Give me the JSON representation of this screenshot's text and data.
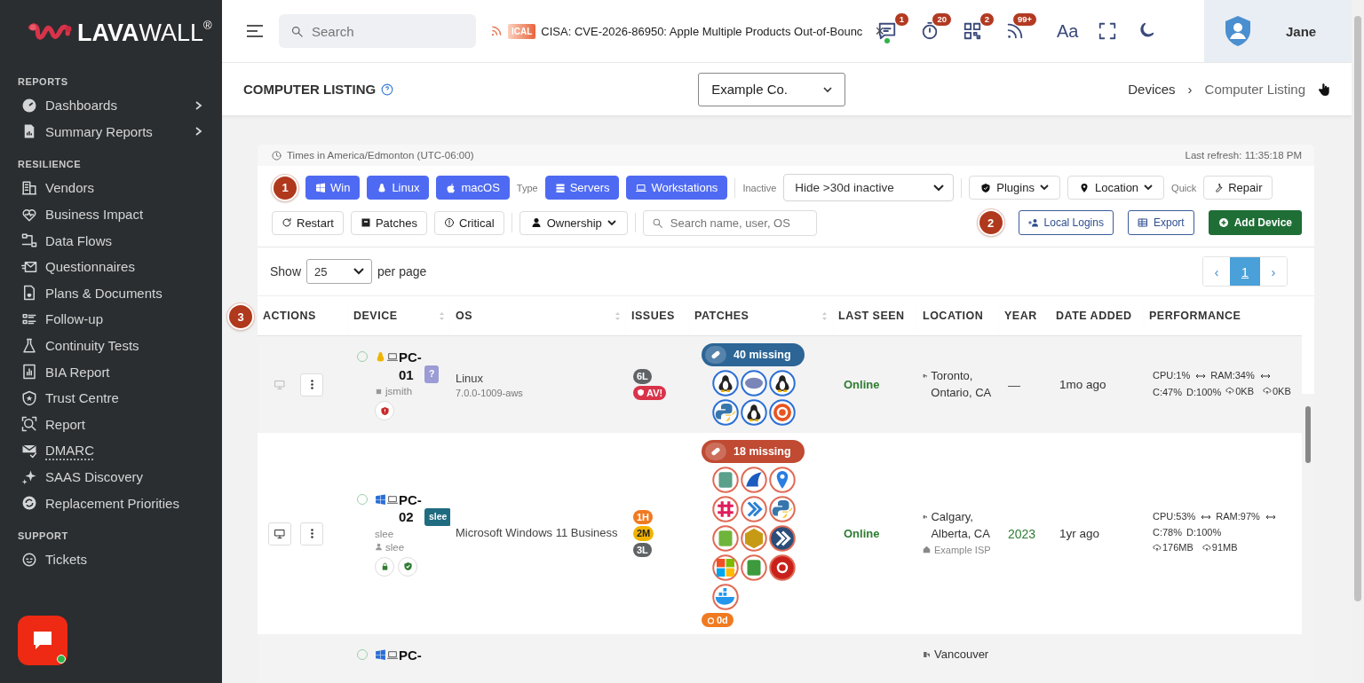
{
  "sidebar": {
    "logo": "**LAVA**WALL$^{®}$",
    "sections": [
      {
        "title": "REPORTS",
        "items": [
          {
            "label": "Dashboards",
            "has_submenu": true,
            "underlined": false
          },
          {
            "label": "Summary Reports",
            "has_submenu": true,
            "underlined": false
          }
        ]
      },
      {
        "title": "RESILIENCE",
        "items": [
          {
            "label": "Vendors",
            "has_submenu": false,
            "underlined": false
          },
          {
            "label": "Business Impact",
            "has_submenu": false,
            "underlined": false
          },
          {
            "label": "Data Flows",
            "has_submenu": false,
            "underlined": false
          },
          {
            "label": "Questionnaires",
            "has_submenu": false,
            "underlined": false
          },
          {
            "label": "Plans & Documents",
            "has_submenu": false,
            "underlined": false
          },
          {
            "label": "Follow-up",
            "has_submenu": false,
            "underlined": false
          },
          {
            "label": "Continuity Tests",
            "has_submenu": false,
            "underlined": false
          },
          {
            "label": "BIA Report",
            "has_submenu": false,
            "underlined": false
          },
          {
            "label": "Trust Centre",
            "has_submenu": false,
            "underlined": false
          },
          {
            "label": "Report",
            "has_submenu": false,
            "underlined": false
          },
          {
            "label": "DMARC",
            "has_submenu": false,
            "underlined": true
          },
          {
            "label": "SAAS Discovery",
            "has_submenu": false,
            "underlined": false
          },
          {
            "label": "Replacement Priorities",
            "has_submenu": false,
            "underlined": false
          }
        ]
      },
      {
        "title": "SUPPORT",
        "items": [
          {
            "label": "Tickets",
            "has_submenu": false,
            "underlined": false
          }
        ]
      }
    ],
    "chat": {
      "online": true
    }
  },
  "topbar": {
    "search": {
      "placeholder": "Search"
    },
    "news": {
      "tag": "ICAL",
      "text": "CISA: CVE-2026-86950: Apple Multiple Products Out-of-Bounc",
      "close": "×"
    },
    "notifications": [
      {
        "kind": "chat",
        "badge": "1",
        "dot": true
      },
      {
        "kind": "timer",
        "badge": "20",
        "dot": false
      },
      {
        "kind": "qr",
        "badge": "2",
        "dot": false
      },
      {
        "kind": "feed",
        "badge": "99+",
        "dot": false
      }
    ],
    "font_button": "Aa",
    "user": {
      "name": "Jane"
    }
  },
  "header": {
    "title": "COMPUTER LISTING",
    "company": "Example Co.",
    "breadcrumb": [
      "Devices",
      "Computer Listing"
    ],
    "separator": "›"
  },
  "listing": {
    "timezone": "Times in America/Edmonton (UTC-06:00)",
    "last_refresh": "Last refresh: 11:35:18 PM",
    "tour_markers": [
      "1",
      "2",
      "3"
    ],
    "os_filters": [
      {
        "label": "Win",
        "kind": "windows",
        "selected": true
      },
      {
        "label": "Linux",
        "kind": "penguin",
        "selected": true
      },
      {
        "label": "macOS",
        "kind": "apple",
        "selected": true
      }
    ],
    "type_label": "Type",
    "type_filters": [
      {
        "label": "Servers",
        "kind": "server",
        "selected": true
      },
      {
        "label": "Workstations",
        "kind": "laptop",
        "selected": true
      }
    ],
    "inactive_label": "Inactive",
    "inactive_select": "Hide >30d inactive",
    "dropdowns": [
      {
        "label": "Plugins",
        "kind": "shield"
      },
      {
        "label": "Location",
        "kind": "pin"
      }
    ],
    "quick_label": "Quick",
    "quick_actions": [
      {
        "label": "Repair",
        "kind": "wrench"
      },
      {
        "label": "Restart",
        "kind": "restart"
      },
      {
        "label": "Patches",
        "kind": "box"
      },
      {
        "label": "Critical",
        "kind": "alert"
      }
    ],
    "ownership": "Ownership",
    "device_search": {
      "placeholder": "Search name, user, OS"
    },
    "actions": [
      {
        "label": "Local Logins",
        "kind": "outline"
      },
      {
        "label": "Export",
        "kind": "outline"
      },
      {
        "label": "Add Device",
        "kind": "primary"
      }
    ],
    "page_size": {
      "prefix": "Show",
      "value": "25",
      "suffix": "per page"
    },
    "pagination": {
      "prev": "‹",
      "next": "›",
      "pages": [
        {
          "label": "1",
          "selected": true
        }
      ]
    },
    "table": {
      "columns": [
        {
          "label": "ACTIONS",
          "sortable": false
        },
        {
          "label": "DEVICE",
          "sortable": true
        },
        {
          "label": "OS",
          "sortable": true
        },
        {
          "label": "ISSUES",
          "sortable": false
        },
        {
          "label": "PATCHES",
          "sortable": true
        },
        {
          "label": "LAST SEEN",
          "sortable": false
        },
        {
          "label": "LOCATION",
          "sortable": false
        },
        {
          "label": "YEAR",
          "sortable": false
        },
        {
          "label": "DATE ADDED",
          "sortable": false
        },
        {
          "label": "PERFORMANCE",
          "sortable": false
        }
      ],
      "rows": [
        {
          "kind": "linux",
          "remote_enabled": false,
          "device": {
            "name": "PC-01",
            "tag": {
              "label": "?",
              "color": "#9b9bd6"
            },
            "user": "jsmith",
            "shields": [
              {
                "kind": "alert"
              }
            ]
          },
          "os": {
            "name": "Linux",
            "version": "7.0.0-1009-aws"
          },
          "issues": [
            {
              "text": "6L",
              "kind": "low"
            },
            {
              "text": "AV!",
              "kind": "alert"
            }
          ],
          "patches": {
            "missing": "40 missing",
            "kind": "info",
            "apps": [
              {
                "kind": "penguin"
              },
              {
                "kind": "elephant"
              },
              {
                "kind": "penguin"
              },
              {
                "kind": "snake"
              },
              {
                "kind": "penguin"
              },
              {
                "kind": "ring"
              }
            ]
          },
          "last_seen": {
            "text": "Online",
            "online": true
          },
          "location": {
            "text": "Toronto, Ontario, CA"
          },
          "year": {
            "text": "—",
            "known": false
          },
          "date_added": "1mo ago",
          "performance": {
            "cpu": "CPU:1%",
            "ram": "RAM:34%",
            "c": "C:47%",
            "d": "D:100%",
            "up": "0KB",
            "down": "0KB"
          }
        },
        {
          "kind": "windows",
          "remote_enabled": true,
          "device": {
            "name": "PC-02",
            "tag": {
              "label": "slee",
              "color": "#1f6b80"
            },
            "subtitle": "slee",
            "user": "slee",
            "shields": [
              {
                "kind": "lock"
              },
              {
                "kind": "check"
              }
            ]
          },
          "os": {
            "name": "Microsoft Windows 11 Business"
          },
          "issues": [
            {
              "text": "1H",
              "kind": "high"
            },
            {
              "text": "2M",
              "kind": "medium"
            },
            {
              "text": "3L",
              "kind": "low"
            }
          ],
          "patches": {
            "missing": "18 missing",
            "kind": "high",
            "apps": [
              {
                "kind": "tile"
              },
              {
                "kind": "fin"
              },
              {
                "kind": "pin"
              },
              {
                "kind": "hash"
              },
              {
                "kind": "arrow"
              },
              {
                "kind": "snake"
              },
              {
                "kind": "notepad"
              },
              {
                "kind": "hexagon"
              },
              {
                "kind": "feather"
              },
              {
                "kind": "grid"
              },
              {
                "kind": "document"
              },
              {
                "kind": "letter"
              },
              {
                "kind": "whale"
              }
            ],
            "age": "0d"
          },
          "last_seen": {
            "text": "Online",
            "online": true
          },
          "location": {
            "text": "Calgary, Alberta, CA",
            "isp": "Example ISP"
          },
          "year": {
            "text": "2023",
            "known": true
          },
          "date_added": "1yr ago",
          "performance": {
            "cpu": "CPU:53%",
            "ram": "RAM:97%",
            "c": "C:78%",
            "d": "D:100%",
            "up": "176MB",
            "down": "91MB"
          }
        },
        {
          "kind": "windows",
          "device": {
            "name": "PC-"
          },
          "location": {
            "text": "Vancouver"
          }
        }
      ]
    }
  }
}
